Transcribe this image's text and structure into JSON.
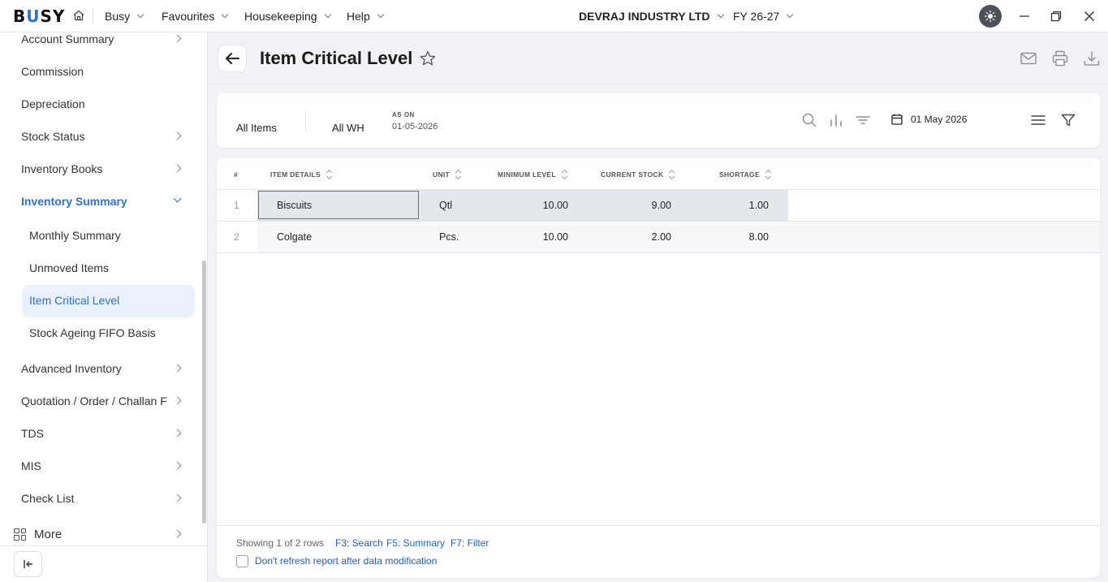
{
  "topbar": {
    "logo_b": "B",
    "logo_u": "U",
    "logo_rest": "SY",
    "menus": [
      "Busy",
      "Favourites",
      "Housekeeping",
      "Help"
    ],
    "company": "DEVRAJ INDUSTRY LTD",
    "fy": "FY 26-27"
  },
  "sidebar": {
    "items": [
      "Account Summary",
      "Commission",
      "Depreciation",
      "Stock Status",
      "Inventory Books",
      "Inventory Summary",
      "Monthly Summary",
      "Unmoved Items",
      "Item Critical Level",
      "Stock Ageing FIFO Basis",
      "Advanced Inventory",
      "Quotation / Order / Challan F",
      "TDS",
      "MIS",
      "Check List"
    ],
    "more_label": "More"
  },
  "header": {
    "title": "Item Critical Level"
  },
  "filters": {
    "items": "All Items",
    "warehouse": "All WH",
    "as_on_label": "AS ON",
    "as_on_date": "01-05-2026",
    "date_pill": "01 May 2026"
  },
  "table": {
    "columns": [
      "#",
      "ITEM DETAILS",
      "UNIT",
      "MINIMUM LEVEL",
      "CURRENT STOCK",
      "SHORTAGE"
    ],
    "rows": [
      {
        "idx": "1",
        "item": "Biscuits",
        "unit": "Qtl",
        "min": "10.00",
        "current": "9.00",
        "shortage": "1.00"
      },
      {
        "idx": "2",
        "item": "Colgate",
        "unit": "Pcs.",
        "min": "10.00",
        "current": "2.00",
        "shortage": "8.00"
      }
    ]
  },
  "footer": {
    "showing": "Showing 1 of 2 rows",
    "f3": "F3: Search",
    "f5": "F5: Summary",
    "f7": "F7: Filter",
    "refresh_label": "Don't refresh report after data modification"
  },
  "colors": {
    "accent": "#2f6fd6",
    "link": "#1f5fbf",
    "row_selected_bg": "#e4e7ec",
    "row_alt_bg": "#f6f7f9"
  }
}
